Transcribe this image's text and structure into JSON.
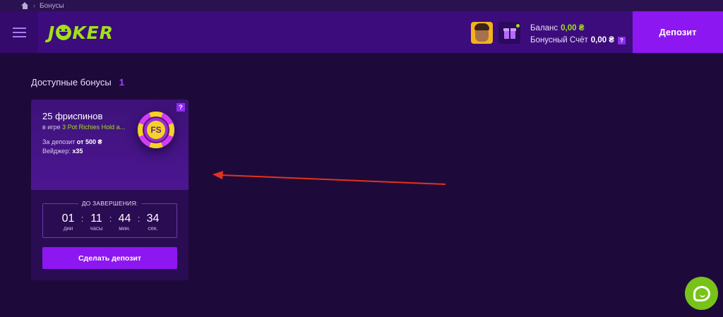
{
  "breadcrumb": {
    "home_icon": "home-icon",
    "separator": "›",
    "current": "Бонусы"
  },
  "header": {
    "menu_icon": "hamburger-menu-icon",
    "logo_text_1": "J",
    "logo_text_2": "KER",
    "balance_label": "Баланс",
    "balance_value": "0,00 ₴",
    "bonus_label": "Бонусный Счёт",
    "bonus_value": "0,00 ₴",
    "bonus_help": "?",
    "deposit_label": "Депозит"
  },
  "section": {
    "title": "Доступные бонусы",
    "count": "1"
  },
  "bonus_card": {
    "help": "?",
    "title": "25 фриспинов",
    "game_prefix": "в игре",
    "game_name": "3 Pot Richies Hold a...",
    "deposit_prefix": "За депозит",
    "deposit_value": "от 500 ₴",
    "wager_label": "Вейджер:",
    "wager_value": "x35",
    "chip_text": "FS",
    "timer_label": "ДО ЗАВЕРШЕНИЯ:",
    "timer": [
      {
        "value": "01",
        "unit": "дни"
      },
      {
        "value": "11",
        "unit": "часы"
      },
      {
        "value": "44",
        "unit": "мин."
      },
      {
        "value": "34",
        "unit": "сек."
      }
    ],
    "colon": ":",
    "button_label": "Сделать депозит"
  },
  "colors": {
    "background": "#1e0a3a",
    "header": "#3c0c7c",
    "accent_purple": "#8d17f0",
    "accent_green": "#a2e01a",
    "annotation_arrow": "#e5321c"
  },
  "chat_icon": "chat-bubble-icon"
}
